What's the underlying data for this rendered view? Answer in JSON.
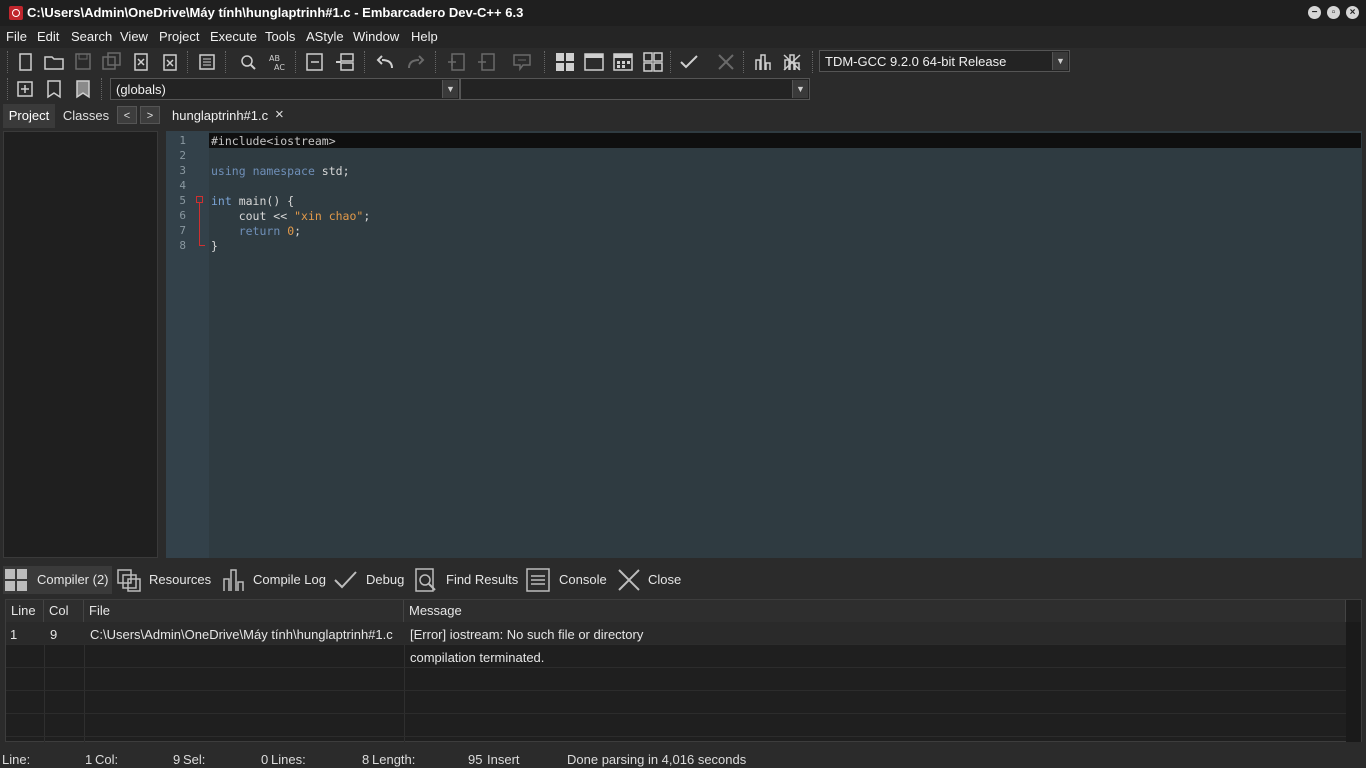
{
  "window": {
    "title": "C:\\Users\\Admin\\OneDrive\\Máy tính\\hunglaptrinh#1.c - Embarcadero Dev-C++ 6.3",
    "controls": [
      "minimize",
      "restore",
      "close"
    ]
  },
  "menu": [
    "File",
    "Edit",
    "Search",
    "View",
    "Project",
    "Execute",
    "Tools",
    "AStyle",
    "Window",
    "Help"
  ],
  "toolbar": {
    "compiler_select": "TDM-GCC 9.2.0 64-bit Release",
    "scope_select": "(globals)",
    "member_select": ""
  },
  "left_panel": {
    "tabs": [
      "Project",
      "Classes"
    ]
  },
  "editor": {
    "tab_label": "hunglaptrinh#1.c",
    "line_numbers": [
      "1",
      "2",
      "3",
      "4",
      "5",
      "6",
      "7",
      "8"
    ],
    "lines": {
      "l1": "#include<iostream>",
      "l3a": "using",
      "l3b": "namespace",
      "l3c": " std;",
      "l5a": "int",
      "l5b": " main() {",
      "l6a": "    cout << ",
      "l6b": "\"xin chao\"",
      "l6c": ";",
      "l7a": "    ",
      "l7b": "return",
      "l7c": " ",
      "l7d": "0",
      "l7e": ";",
      "l8": "}"
    }
  },
  "bottom_tabs": {
    "compiler": "Compiler (2)",
    "resources": "Resources",
    "compile_log": "Compile Log",
    "debug": "Debug",
    "find_results": "Find Results",
    "console": "Console",
    "close": "Close"
  },
  "messages": {
    "headers": {
      "line": "Line",
      "col": "Col",
      "file": "File",
      "message": "Message"
    },
    "rows": [
      {
        "line": "1",
        "col": "9",
        "file": "C:\\Users\\Admin\\OneDrive\\Máy tính\\hunglaptrinh#1.c",
        "message": "[Error] iostream: No such file or directory"
      },
      {
        "line": "",
        "col": "",
        "file": "",
        "message": "compilation terminated."
      }
    ]
  },
  "status": {
    "line_label": "Line:",
    "line_value": "1",
    "col_label": "Col:",
    "col_value": "9",
    "sel_label": "Sel:",
    "sel_value": "0",
    "lines_label": "Lines:",
    "lines_value": "8",
    "length_label": "Length:",
    "length_value": "95",
    "mode": "Insert",
    "parse_msg": "Done parsing in 4,016 seconds"
  }
}
